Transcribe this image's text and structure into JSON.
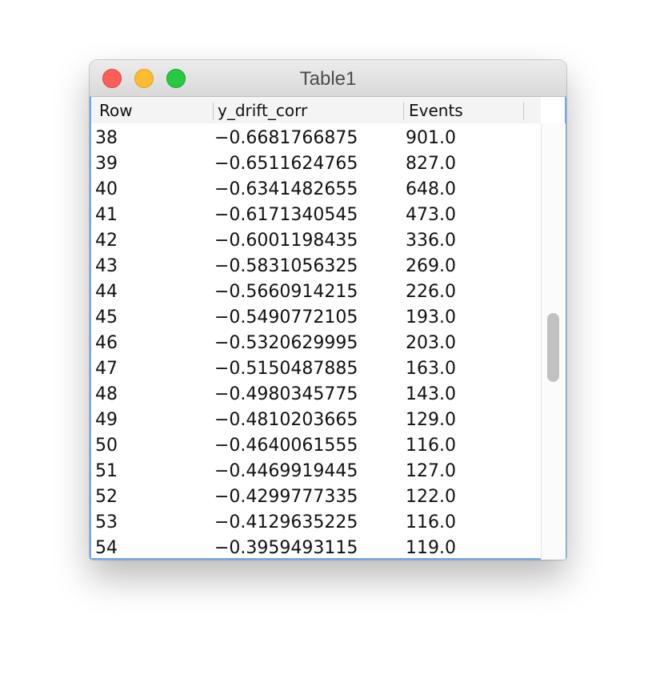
{
  "window": {
    "title": "Table1"
  },
  "table": {
    "columns": [
      "Row",
      "y_drift_corr",
      "Events"
    ],
    "rows": [
      [
        "38",
        "−0.6681766875",
        "901.0"
      ],
      [
        "39",
        "−0.6511624765",
        "827.0"
      ],
      [
        "40",
        "−0.6341482655",
        "648.0"
      ],
      [
        "41",
        "−0.6171340545",
        "473.0"
      ],
      [
        "42",
        "−0.6001198435",
        "336.0"
      ],
      [
        "43",
        "−0.5831056325",
        "269.0"
      ],
      [
        "44",
        "−0.5660914215",
        "226.0"
      ],
      [
        "45",
        "−0.5490772105",
        "193.0"
      ],
      [
        "46",
        "−0.5320629995",
        "203.0"
      ],
      [
        "47",
        "−0.5150487885",
        "163.0"
      ],
      [
        "48",
        "−0.4980345775",
        "143.0"
      ],
      [
        "49",
        "−0.4810203665",
        "129.0"
      ],
      [
        "50",
        "−0.4640061555",
        "116.0"
      ],
      [
        "51",
        "−0.4469919445",
        "127.0"
      ],
      [
        "52",
        "−0.4299777335",
        "122.0"
      ],
      [
        "53",
        "−0.4129635225",
        "116.0"
      ],
      [
        "54",
        "−0.3959493115",
        "119.0"
      ]
    ]
  },
  "icons": {
    "close": "close-traffic-light",
    "minimize": "minimize-traffic-light",
    "zoom": "zoom-traffic-light"
  },
  "colors": {
    "close": "#fc5f57",
    "minimize": "#fdbb2f",
    "zoom": "#28c840",
    "focus_border": "#6aaaf0"
  }
}
